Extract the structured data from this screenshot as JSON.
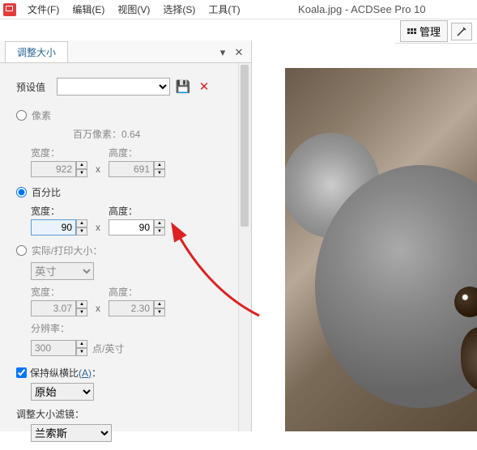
{
  "menu": {
    "file": "文件(F)",
    "edit": "编辑(E)",
    "view": "视图(V)",
    "select": "选择(S)",
    "tools": "工具(T)"
  },
  "title": "Koala.jpg - ACDSee Pro 10",
  "toolbar": {
    "manage": "管理"
  },
  "tab": {
    "resize": "调整大小"
  },
  "preset": {
    "label": "预设值"
  },
  "pixels": {
    "label": "像素",
    "mp_label": "百万像素：",
    "mp_value": "0.64",
    "width_label": "宽度：",
    "height_label": "高度：",
    "width_value": "922",
    "height_value": "691"
  },
  "percent": {
    "label": "百分比",
    "width_label": "宽度：",
    "height_label": "高度：",
    "width_value": "90",
    "height_value": "90"
  },
  "print": {
    "label": "实际/打印大小：",
    "unit": "英寸",
    "width_label": "宽度：",
    "height_label": "高度：",
    "width_value": "3.07",
    "height_value": "2.30",
    "res_label": "分辨率：",
    "res_value": "300",
    "res_unit": "点/英寸"
  },
  "aspect": {
    "label": "保持纵横比",
    "link": "(A)",
    "option": "原始"
  },
  "filter": {
    "label": "调整大小滤镜：",
    "option": "兰索斯"
  }
}
